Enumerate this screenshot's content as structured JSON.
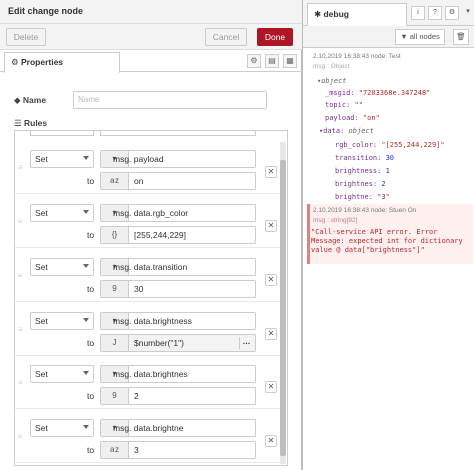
{
  "tray": {
    "title": "Edit change node",
    "delete_label": "Delete",
    "cancel_label": "Cancel",
    "done_label": "Done",
    "tab_label": "Properties",
    "name_label": "Name",
    "name_placeholder": "Name",
    "rules_label": "Rules"
  },
  "rules": [
    {
      "action": "Set",
      "prop_type": "msg.",
      "prop": "payload",
      "to_type": "a z",
      "to_value": "on"
    },
    {
      "action": "Set",
      "prop_type": "msg.",
      "prop": "data.rgb_color",
      "to_type": "{}",
      "to_value": "[255,244,229]"
    },
    {
      "action": "Set",
      "prop_type": "msg.",
      "prop": "data.transition",
      "to_type": "9",
      "to_value": "30"
    },
    {
      "action": "Set",
      "prop_type": "msg.",
      "prop": "data.brightness",
      "to_type": "J",
      "to_value": "$number(\"1\")"
    },
    {
      "action": "Set",
      "prop_type": "msg.",
      "prop": "data.brightnes",
      "to_type": "9",
      "to_value": "2"
    },
    {
      "action": "Set",
      "prop_type": "msg.",
      "prop": "data.brightne",
      "to_type": "a z",
      "to_value": "3"
    }
  ],
  "sidebar": {
    "tab_label": "debug",
    "filter_label": "all nodes",
    "msg1": {
      "meta": "2.10.2019 16:38:43   node: Test",
      "type": "msg : Object",
      "root": "object",
      "_msgid_key": "_msgid:",
      "_msgid_val": "\"7203368e.347248\"",
      "topic_key": "topic:",
      "topic_val": "\"\"",
      "payload_key": "payload:",
      "payload_val": "\"on\"",
      "data_key": "data:",
      "data_type": "object",
      "rgb_key": "rgb_color:",
      "rgb_val": "\"[255,244,229]\"",
      "transition_key": "transition:",
      "transition_val": "30",
      "brightness_key": "brightness:",
      "brightness_val": "1",
      "brightnes_key": "brightnes:",
      "brightnes_val": "2",
      "brightne_key": "brightne:",
      "brightne_val": "\"3\""
    },
    "msg2": {
      "meta": "2.10.2019 16:38:43   node: Stuen On",
      "type": "msg : string[92]",
      "text": "\"Call-service API error. Error\nMessage: expected int for dictionary\nvalue @ data[\"brightness\"]\""
    }
  }
}
